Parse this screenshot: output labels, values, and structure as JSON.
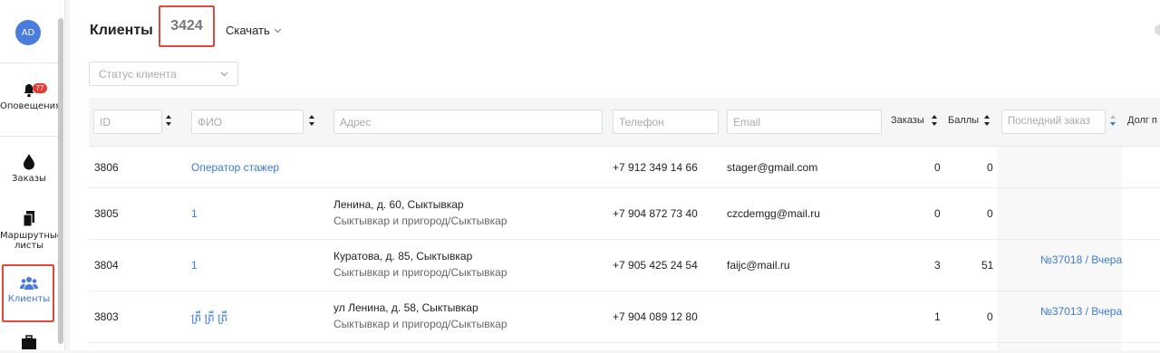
{
  "user": {
    "initials": "AD"
  },
  "sidebar": {
    "items": [
      {
        "label": "Оповещения",
        "icon": "bell-icon",
        "badge": "77"
      },
      {
        "label": "Заказы",
        "icon": "drop-icon"
      },
      {
        "label": "Маршрутные листы",
        "icon": "documents-icon"
      },
      {
        "label": "Клиенты",
        "icon": "users-icon",
        "active": true
      },
      {
        "label": "",
        "icon": "briefcase-icon"
      }
    ]
  },
  "header": {
    "title": "Клиенты",
    "count": "3424",
    "download": "Скачать"
  },
  "filters": {
    "status_placeholder": "Статус клиента"
  },
  "table": {
    "columns": {
      "id": "ID",
      "name": "ФИО",
      "address": "Адрес",
      "phone": "Телефон",
      "email": "Email",
      "orders": "Заказы",
      "points": "Баллы",
      "last_order": "Последний заказ",
      "debt": "Долг п"
    },
    "rows": [
      {
        "id": "3806",
        "name": "Оператор стажер",
        "address": "",
        "address_sub": "",
        "phone": "+7 912 349 14 66",
        "email": "stager@gmail.com",
        "orders": "0",
        "points": "0",
        "last_order": ""
      },
      {
        "id": "3805",
        "name": "1",
        "address": "Ленина, д. 60, Сыктывкар",
        "address_sub": "Сыктывкар и пригород/Сыктывкар",
        "phone": "+7 904 872 73 40",
        "email": "czcdemgg@mail.ru",
        "orders": "0",
        "points": "0",
        "last_order": ""
      },
      {
        "id": "3804",
        "name": "1",
        "address": "Куратова, д. 85, Сыктывкар",
        "address_sub": "Сыктывкар и пригород/Сыктывкар",
        "phone": "+7 905 425 24 54",
        "email": "faijc@mail.ru",
        "orders": "3",
        "points": "51",
        "last_order": "№37018 / Вчера"
      },
      {
        "id": "3803",
        "name": "ត្រឹ ត្រឹ ត្រឹ",
        "address": "ул Ленина, д. 58, Сыктывкар",
        "address_sub": "Сыктывкар и пригород/Сыктывкар",
        "phone": "+7 904 089 12 80",
        "email": "",
        "orders": "1",
        "points": "0",
        "last_order": "№37013 / Вчера"
      }
    ]
  }
}
